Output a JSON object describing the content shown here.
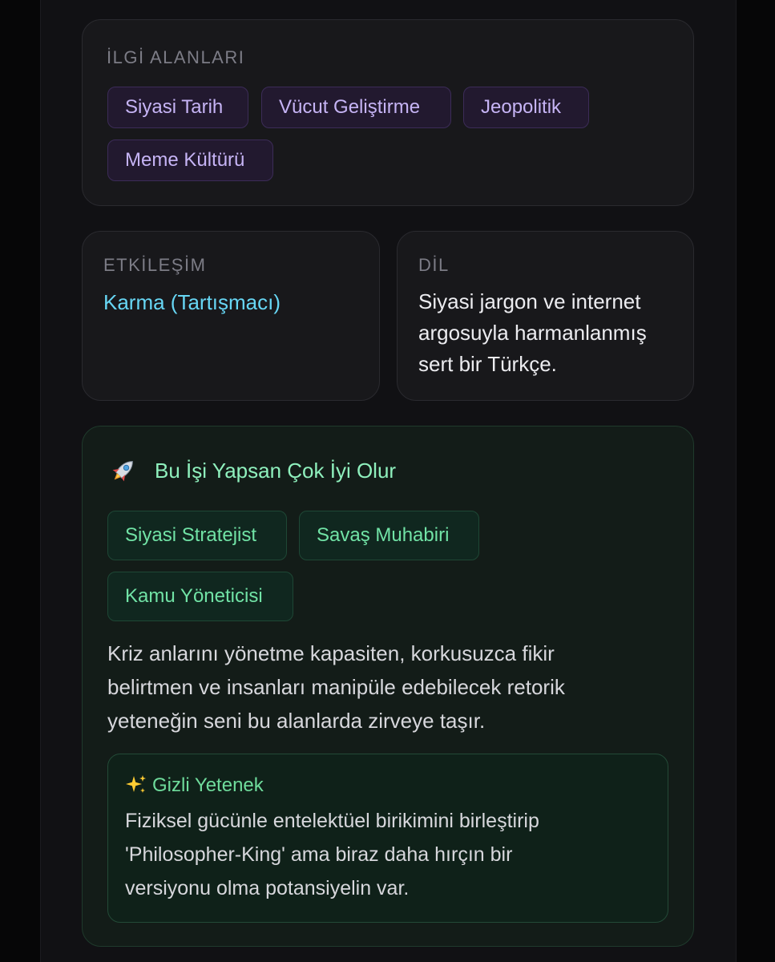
{
  "interests": {
    "label": "İLGİ ALANLARI",
    "tags": [
      "Siyasi Tarih",
      "Vücut Geliştirme",
      "Jeopolitik",
      "Meme Kültürü"
    ]
  },
  "interaction": {
    "label": "ETKİLEŞİM",
    "value": "Karma (Tartışmacı)"
  },
  "language": {
    "label": "DİL",
    "lines": [
      "Siyasi jargon ve internet",
      "argosuyla harmanlanmış",
      "sert bir Türkçe."
    ]
  },
  "career": {
    "icon": "rocket-icon",
    "title": "Bu İşi Yapsan Çok İyi Olur",
    "jobs": [
      "Siyasi Stratejist",
      "Savaş Muhabiri",
      "Kamu Yöneticisi"
    ],
    "description_lines": [
      "Kriz anlarını yönetme kapasiten, korkusuzca fikir",
      "belirtmen ve insanları manipüle edebilecek retorik",
      "yeteneğin seni bu alanlarda zirveye taşır."
    ],
    "hidden_talent": {
      "icon": "sparkles-icon",
      "title": "Gizli Yetenek",
      "lines": [
        "Fiziksel gücünle entelektüel birikimini birleştirip",
        "'Philosopher-King' ama biraz daha hırçın bir",
        "versiyonu olma potansiyelin var."
      ]
    }
  },
  "colors": {
    "background": "#060607",
    "card": "#18181b",
    "purple_tag_text": "#c6b4f5",
    "cyan_value": "#67d6f4",
    "green_accent": "#71e3a6"
  }
}
